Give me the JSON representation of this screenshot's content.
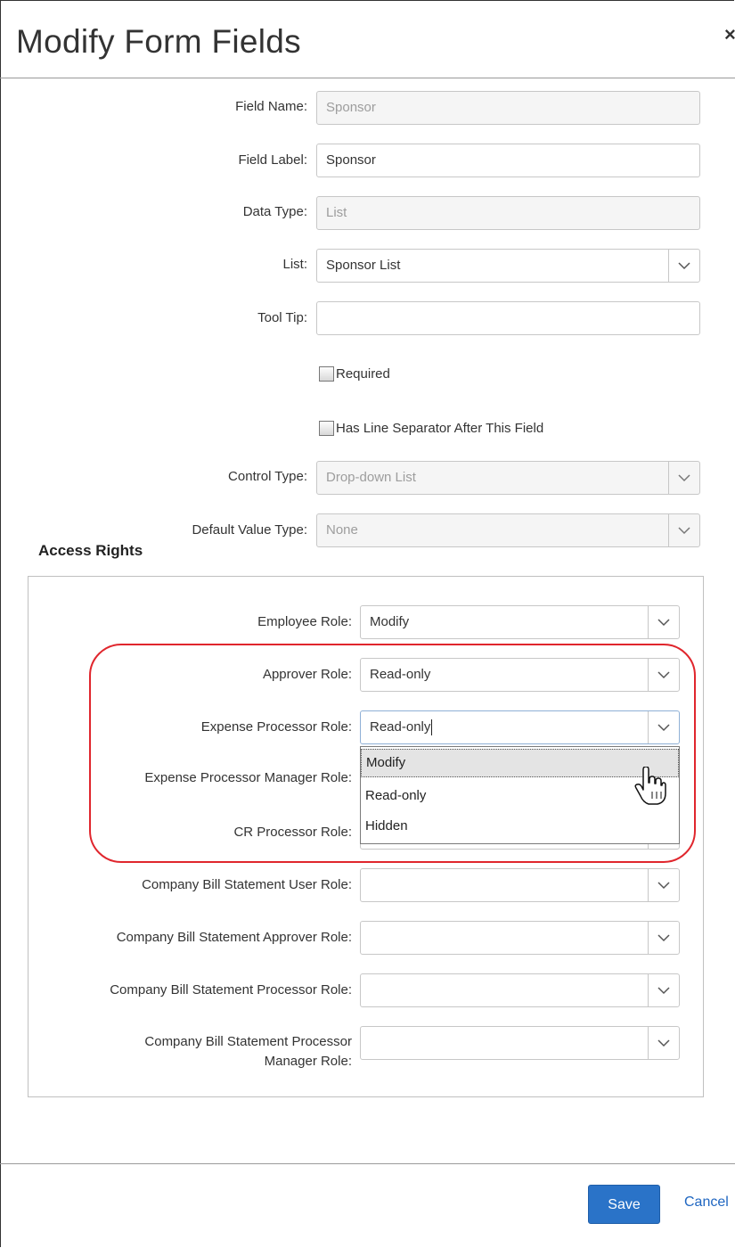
{
  "dialog": {
    "title": "Modify Form Fields",
    "close_glyph": "×"
  },
  "fields": {
    "field_name": {
      "label": "Field Name:",
      "value": "Sponsor"
    },
    "field_label": {
      "label": "Field Label:",
      "value": "Sponsor"
    },
    "data_type": {
      "label": "Data Type:",
      "value": "List"
    },
    "list": {
      "label": "List:",
      "value": "Sponsor List"
    },
    "tool_tip": {
      "label": "Tool Tip:",
      "value": ""
    },
    "required": {
      "label": "Required",
      "checked": false
    },
    "line_separator": {
      "label": "Has Line Separator After This Field",
      "checked": false
    },
    "control_type": {
      "label": "Control Type:",
      "value": "Drop-down List"
    },
    "default_value_type": {
      "label": "Default Value Type:",
      "value": "None"
    }
  },
  "access_rights": {
    "legend": "Access Rights",
    "roles": [
      {
        "label": "Employee Role:",
        "value": "Modify"
      },
      {
        "label": "Approver Role:",
        "value": "Read-only"
      },
      {
        "label": "Expense Processor Role:",
        "value": "Read-only"
      },
      {
        "label": "Expense Processor Manager Role:",
        "value": ""
      },
      {
        "label": "CR Processor Role:",
        "value": ""
      },
      {
        "label": "Company Bill Statement User Role:",
        "value": ""
      },
      {
        "label": "Company Bill Statement Approver Role:",
        "value": ""
      },
      {
        "label": "Company Bill Statement Processor Role:",
        "value": ""
      },
      {
        "label_line1": "Company Bill Statement Processor",
        "label_line2": "Manager Role:",
        "value": ""
      }
    ],
    "open_dropdown": {
      "options": [
        "Modify",
        "Read-only",
        "Hidden"
      ],
      "hovered": "Modify"
    }
  },
  "footer": {
    "save_label": "Save",
    "cancel_label": "Cancel"
  },
  "colors": {
    "primary": "#2a73c8",
    "highlight": "#e0262d",
    "link": "#1f66c1"
  },
  "icons": [
    "close-icon",
    "chevron-down-icon",
    "hand-pointer-icon"
  ]
}
